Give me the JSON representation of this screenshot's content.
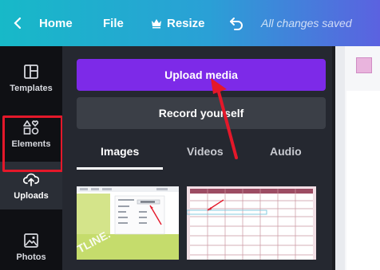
{
  "topbar": {
    "home_label": "Home",
    "file_label": "File",
    "resize_label": "Resize",
    "status": "All changes saved"
  },
  "sidebar": {
    "items": [
      {
        "label": "Templates",
        "icon": "templates-icon"
      },
      {
        "label": "Elements",
        "icon": "elements-icon"
      },
      {
        "label": "Uploads",
        "icon": "upload-cloud-icon"
      },
      {
        "label": "Photos",
        "icon": "photos-icon"
      }
    ]
  },
  "panel": {
    "upload_label": "Upload media",
    "record_label": "Record yourself",
    "tabs": [
      "Images",
      "Videos",
      "Audio"
    ]
  },
  "colors": {
    "accent": "#7d2ae8",
    "highlight": "#e4182a",
    "topbar_start": "#17b9c8",
    "topbar_end": "#5b62e0"
  }
}
